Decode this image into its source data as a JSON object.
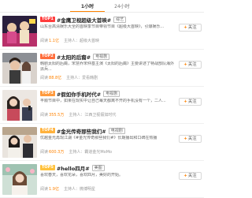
{
  "tabs": [
    {
      "label": "1小时",
      "active": true
    },
    {
      "label": "24小时",
      "active": false
    }
  ],
  "rows": [
    {
      "badge": "TOP1",
      "topic": "#金鹰卫视超级大首映#",
      "category": "综艺",
      "desc": "山东台高清娱乐大全的首映季节目带领节目《超级大首映》，引爆娱乐...",
      "read_label": "阅读",
      "read_count": "1.1亿",
      "host": "主持人：超级大首映",
      "follow": "关注"
    },
    {
      "badge": "TOP2",
      "topic": "#太阳的后裔#",
      "category": "电视剧",
      "desc": "韩剧太阳的后裔，宋慧乔宋仲基主演《太阳的后裔》主要讲述了特战部队海外派兵...",
      "read_label": "阅读",
      "read_count": "88.8亿",
      "host": "主持人：爱看韩剧",
      "follow": "关注"
    },
    {
      "badge": "TOP3",
      "topic": "#假如你手机时代#",
      "category": "电视剧",
      "desc": "丰顺节目中，如果在现实中让自己每天都离不开的手机没有一个，二人...",
      "read_label": "阅读",
      "read_count": "355.5万",
      "host": "主持人：江西卫视假如时代",
      "follow": "关注"
    },
    {
      "badge": "TOP4",
      "topic": "#金光传奇那些我们#",
      "category": "电视剧",
      "desc": "优越金光再现江湖《#金光传奇那些我们#》长期播出和口碑在热播",
      "read_label": "阅读",
      "read_count": "600.3万",
      "host": "主持人：霸道金光MoMo",
      "follow": "关注"
    },
    {
      "badge": "TOP5",
      "topic": "#hello四月#",
      "category": "美图",
      "desc": "喜欢春天，喜欢花朵，喜欢四月，美好的开始。",
      "read_label": "阅读",
      "read_count": "1.9亿",
      "host": "主持人：微博明星",
      "follow": "关注"
    }
  ],
  "colors": {
    "accent": "#ff8200",
    "badge_top1": "#ff3d3d",
    "badge_top2": "#ff6e3d",
    "badge_top3": "#ff9a3d",
    "badge_top4": "#ffb23d",
    "badge_top5": "#ffc23d"
  }
}
